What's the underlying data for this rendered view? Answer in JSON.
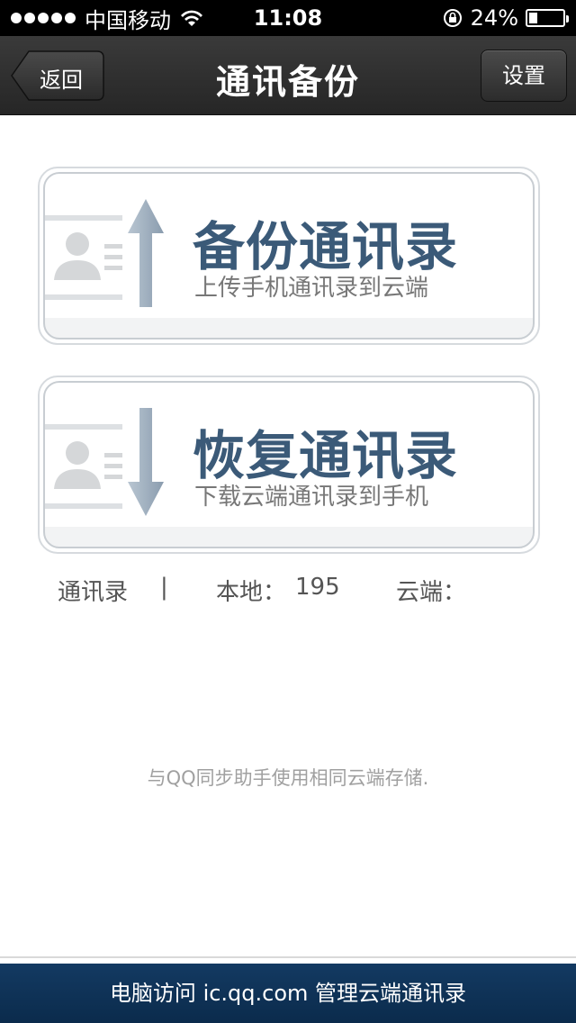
{
  "status_bar": {
    "carrier": "中国移动",
    "time": "11:08",
    "battery_percent_label": "24%",
    "battery_level": 0.24,
    "icons": [
      "signal-dots-icon",
      "wifi-icon",
      "rotation-lock-icon",
      "battery-icon"
    ]
  },
  "nav": {
    "back_label": "返回",
    "title": "通讯备份",
    "settings_label": "设置"
  },
  "cards": {
    "backup": {
      "title": "备份通讯录",
      "subtitle": "上传手机通讯录到云端",
      "icon": "upload-arrow-icon"
    },
    "restore": {
      "title": "恢复通讯录",
      "subtitle": "下载云端通讯录到手机",
      "icon": "download-arrow-icon"
    }
  },
  "stats": {
    "label": "通讯录",
    "separator": "|",
    "local_label": "本地：",
    "local_count": "195",
    "cloud_label": "云端："
  },
  "sync_note": "与QQ同步助手使用相同云端存储.",
  "banner": "电脑访问 ic.qq.com 管理云端通讯录",
  "colors": {
    "nav_background": "#2e2e2e",
    "card_title": "#3b5a78",
    "banner_background": "#0f3358"
  }
}
